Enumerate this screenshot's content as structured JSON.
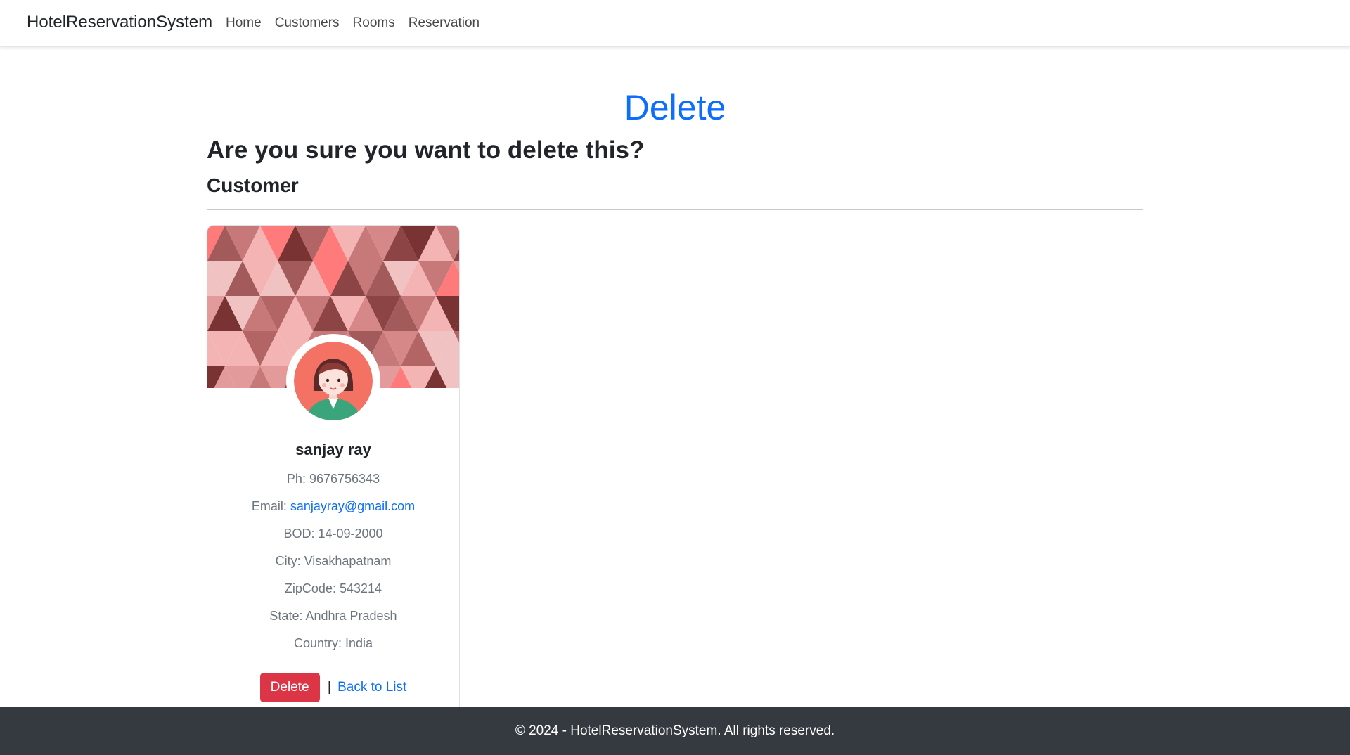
{
  "navbar": {
    "brand": "HotelReservationSystem",
    "links": [
      "Home",
      "Customers",
      "Rooms",
      "Reservation"
    ]
  },
  "page": {
    "title": "Delete",
    "confirm_text": "Are you sure you want to delete this?",
    "section_title": "Customer"
  },
  "customer": {
    "name": "sanjay ray",
    "phone_label": "Ph:",
    "phone": "9676756343",
    "email_label": "Email:",
    "email": "sanjayray@gmail.com",
    "bod_label": "BOD:",
    "bod": "14-09-2000",
    "city_label": "City:",
    "city": "Visakhapatnam",
    "zip_label": "ZipCode:",
    "zip": "543214",
    "state_label": "State:",
    "state": "Andhra Pradesh",
    "country_label": "Country:",
    "country": "India"
  },
  "actions": {
    "delete_label": "Delete",
    "separator": "|",
    "back_label": "Back to List"
  },
  "footer": {
    "text": "© 2024 - HotelReservationSystem. All rights reserved."
  },
  "colors": {
    "primary": "#0d6efd",
    "danger": "#dc3545",
    "footer_bg": "#343a40"
  }
}
